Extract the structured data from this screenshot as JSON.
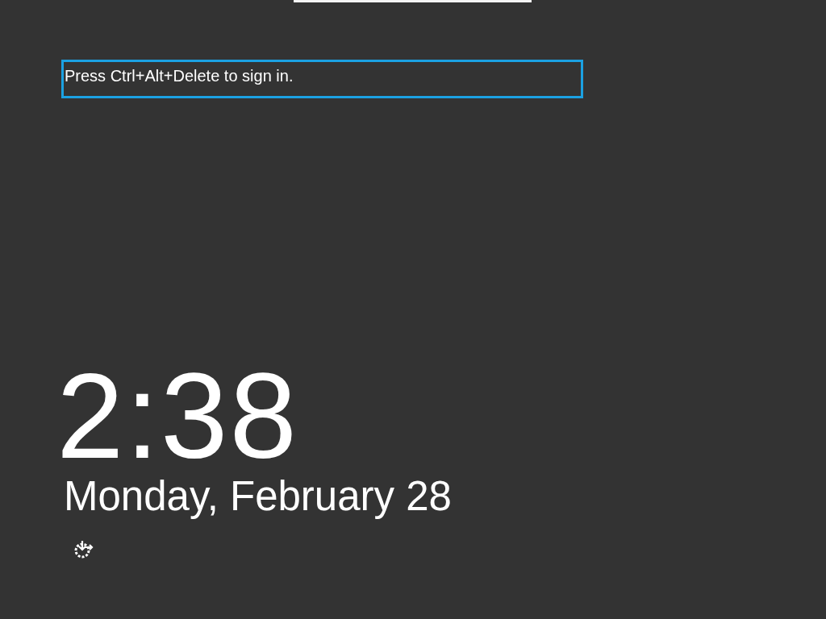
{
  "message": {
    "text": "Press Ctrl+Alt+Delete to sign in."
  },
  "clock": {
    "time": "2:38",
    "date": "Monday, February 28"
  }
}
